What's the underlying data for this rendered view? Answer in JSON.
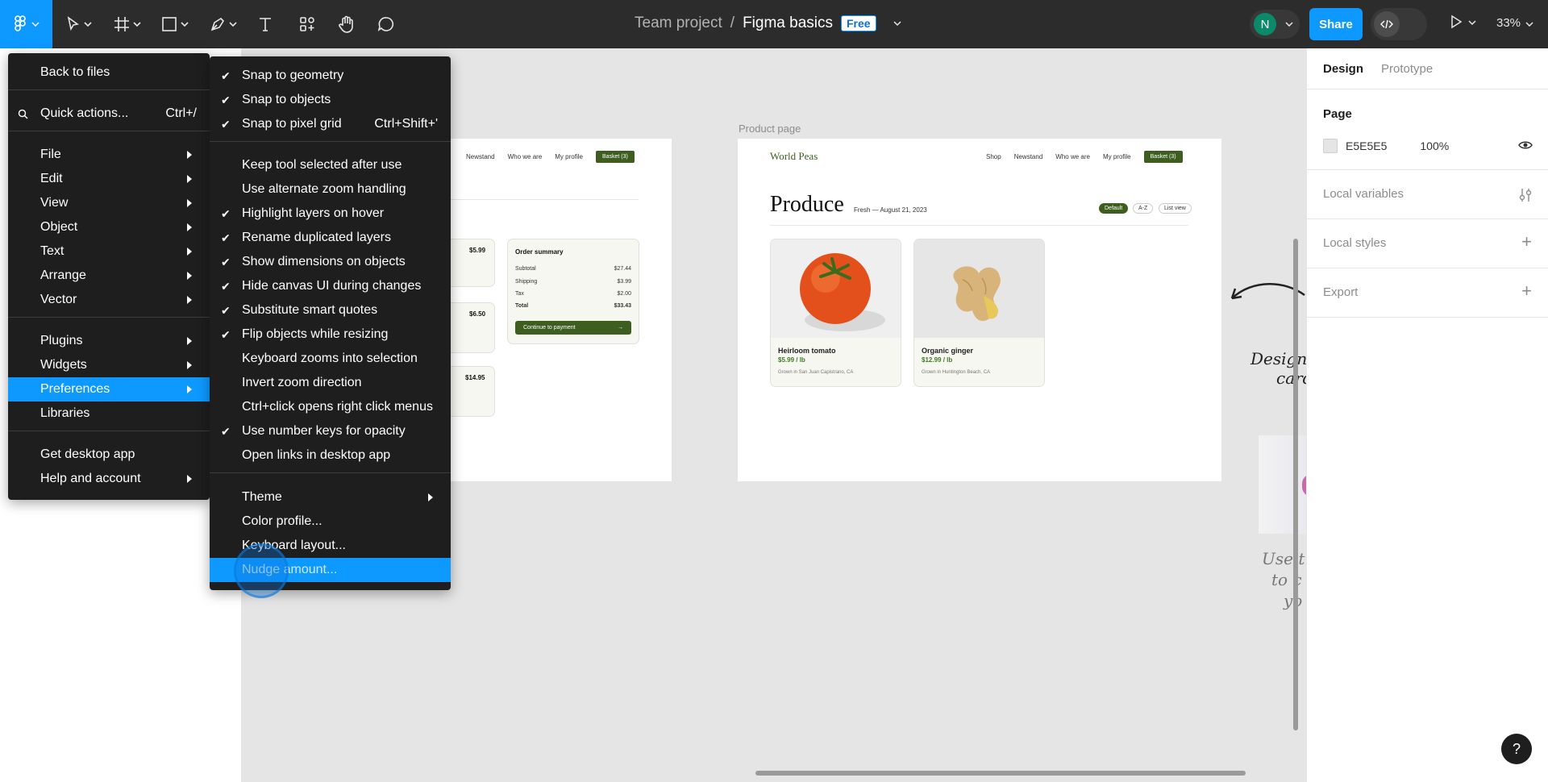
{
  "toolbar": {
    "project": "Team project",
    "separator": "/",
    "file_name": "Figma basics",
    "plan_badge": "Free",
    "avatar_initial": "N",
    "share_label": "Share",
    "dev_mode_icon": "code-icon",
    "zoom": "33%"
  },
  "main_menu": {
    "items": [
      {
        "label": "Back to files"
      },
      {
        "label": "Quick actions...",
        "shortcut": "Ctrl+/"
      },
      {
        "label": "File"
      },
      {
        "label": "Edit"
      },
      {
        "label": "View"
      },
      {
        "label": "Object"
      },
      {
        "label": "Text"
      },
      {
        "label": "Arrange"
      },
      {
        "label": "Vector"
      },
      {
        "label": "Plugins"
      },
      {
        "label": "Widgets"
      },
      {
        "label": "Preferences"
      },
      {
        "label": "Libraries"
      },
      {
        "label": "Get desktop app"
      },
      {
        "label": "Help and account"
      }
    ]
  },
  "preferences_menu": {
    "items": [
      {
        "label": "Snap to geometry",
        "checked": true
      },
      {
        "label": "Snap to objects",
        "checked": true
      },
      {
        "label": "Snap to pixel grid",
        "checked": true,
        "shortcut": "Ctrl+Shift+'"
      },
      {
        "label": "Keep tool selected after use",
        "checked": false
      },
      {
        "label": "Use alternate zoom handling",
        "checked": false
      },
      {
        "label": "Highlight layers on hover",
        "checked": true
      },
      {
        "label": "Rename duplicated layers",
        "checked": true
      },
      {
        "label": "Show dimensions on objects",
        "checked": true
      },
      {
        "label": "Hide canvas UI during changes",
        "checked": true
      },
      {
        "label": "Substitute smart quotes",
        "checked": true
      },
      {
        "label": "Flip objects while resizing",
        "checked": true
      },
      {
        "label": "Keyboard zooms into selection",
        "checked": false
      },
      {
        "label": "Invert zoom direction",
        "checked": false
      },
      {
        "label": "Ctrl+click opens right click menus",
        "checked": false
      },
      {
        "label": "Use number keys for opacity",
        "checked": true
      },
      {
        "label": "Open links in desktop app",
        "checked": false
      },
      {
        "label": "Theme"
      },
      {
        "label": "Color profile..."
      },
      {
        "label": "Keyboard layout..."
      },
      {
        "label": "Nudge amount..."
      }
    ]
  },
  "right_panel": {
    "tabs": [
      "Design",
      "Prototype"
    ],
    "page_heading": "Page",
    "page_color": "E5E5E5",
    "page_opacity": "100%",
    "local_variables": "Local variables",
    "local_styles": "Local styles",
    "export": "Export",
    "help": "?"
  },
  "canvas": {
    "frame_label": "Product page",
    "left_frame": {
      "nav": [
        "Newstand",
        "Who we are",
        "My profile"
      ],
      "basket": "Basket (3)",
      "prices": [
        "$5.99",
        "$6.50",
        "$14.95"
      ],
      "order_summary": {
        "title": "Order summary",
        "rows": [
          {
            "label": "Subtotal",
            "value": "$27.44"
          },
          {
            "label": "Shipping",
            "value": "$3.99"
          },
          {
            "label": "Tax",
            "value": "$2.00"
          },
          {
            "label": "Total",
            "value": "$33.43"
          }
        ],
        "button": "Continue to payment",
        "button_arrow": "→"
      }
    },
    "product_frame": {
      "brand": "World Peas",
      "nav": [
        "Shop",
        "Newstand",
        "Who we are",
        "My profile"
      ],
      "basket": "Basket (3)",
      "heading": "Produce",
      "meta": "Fresh  —  August 21, 2023",
      "pills": [
        "Default",
        "A-Z",
        "List view"
      ],
      "cards": [
        {
          "name": "Heirloom tomato",
          "price": "$5.99 / lb",
          "origin": "Grown in San Juan Capistrano, CA"
        },
        {
          "name": "Organic ginger",
          "price": "$12.99 / lb",
          "origin": "Grown in Huntington Beach, CA"
        }
      ]
    },
    "annotation_1": [
      "Design",
      "card"
    ],
    "annotation_2": [
      "Use t",
      "to c",
      "yo"
    ]
  },
  "colors": {
    "accent": "#0d99ff",
    "toolbar_bg": "#2c2c2c",
    "menu_bg": "#1e1e1e",
    "brand_green": "#3e5e1f"
  }
}
